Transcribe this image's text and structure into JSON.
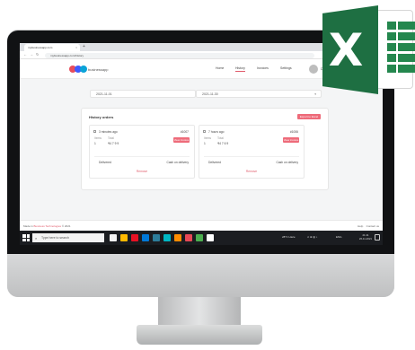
{
  "browser": {
    "tab_title": "mybusinessapp.com",
    "tab_close_glyph": "×",
    "new_tab_glyph": "+",
    "back_glyph": "←",
    "forward_glyph": "→",
    "reload_glyph": "↻",
    "url": "mybusinessapp.com/history",
    "extension_colors": [
      "#5f6368",
      "#1a73e8",
      "#e53935",
      "#444444",
      "#1e88e5"
    ]
  },
  "app": {
    "brand_colors": [
      "#e74c5b",
      "#3d5afe",
      "#0aa3d8"
    ],
    "logo_text": "businessapp",
    "nav": [
      {
        "label": "Home",
        "active": false
      },
      {
        "label": "History",
        "active": true
      },
      {
        "label": "Invoices",
        "active": false
      },
      {
        "label": "Settings",
        "active": false
      }
    ],
    "user_name": "Demo Account",
    "accent_color": "#ee6b7a"
  },
  "filters": {
    "start_date": "2021-11-01",
    "end_date": "2021-11-30",
    "calendar_glyph": "▾"
  },
  "history": {
    "title": "History orders",
    "export_button": "Export to Excel",
    "entries": [
      {
        "time": "3 minutes ago",
        "id": "#1007",
        "qty_label": "Items",
        "qty": "1",
        "total_label": "Total",
        "total": "₹4 7 9 9",
        "button": "View invoice",
        "status": "Delivered",
        "payment": "Cash on delivery",
        "link": "Remove"
      },
      {
        "time": "7 hours ago",
        "id": "#1006",
        "qty_label": "Items",
        "qty": "1",
        "total_label": "Total",
        "total": "₹4 7 6 9",
        "button": "View invoice",
        "status": "Delivered",
        "payment": "Cash on delivery",
        "link": "Remove"
      }
    ]
  },
  "footer": {
    "left_prefix": "Made in",
    "left_accent": "Business Technologies",
    "left_suffix": "© 2021",
    "help": "Help",
    "contact": "Contact us"
  },
  "taskbar": {
    "search_placeholder": "Type here to search",
    "search_glyph": "⌕",
    "app_icon_colors": [
      "#f2f2f2",
      "#ffb900",
      "#e81123",
      "#0078d7",
      "#2d7d9a",
      "#00b7c3",
      "#ff8c00",
      "#e74856",
      "#4caf50",
      "#ffffff"
    ],
    "weather": "28°C Haze",
    "tray_icons": "∧ ⊕ ◍ ♪",
    "language": "ENG",
    "time": "21:41",
    "date": "26-11-2021"
  },
  "excel_logo": {
    "letter": "X",
    "tile_color": "#1e6f42",
    "grid_color": "#24874e"
  }
}
